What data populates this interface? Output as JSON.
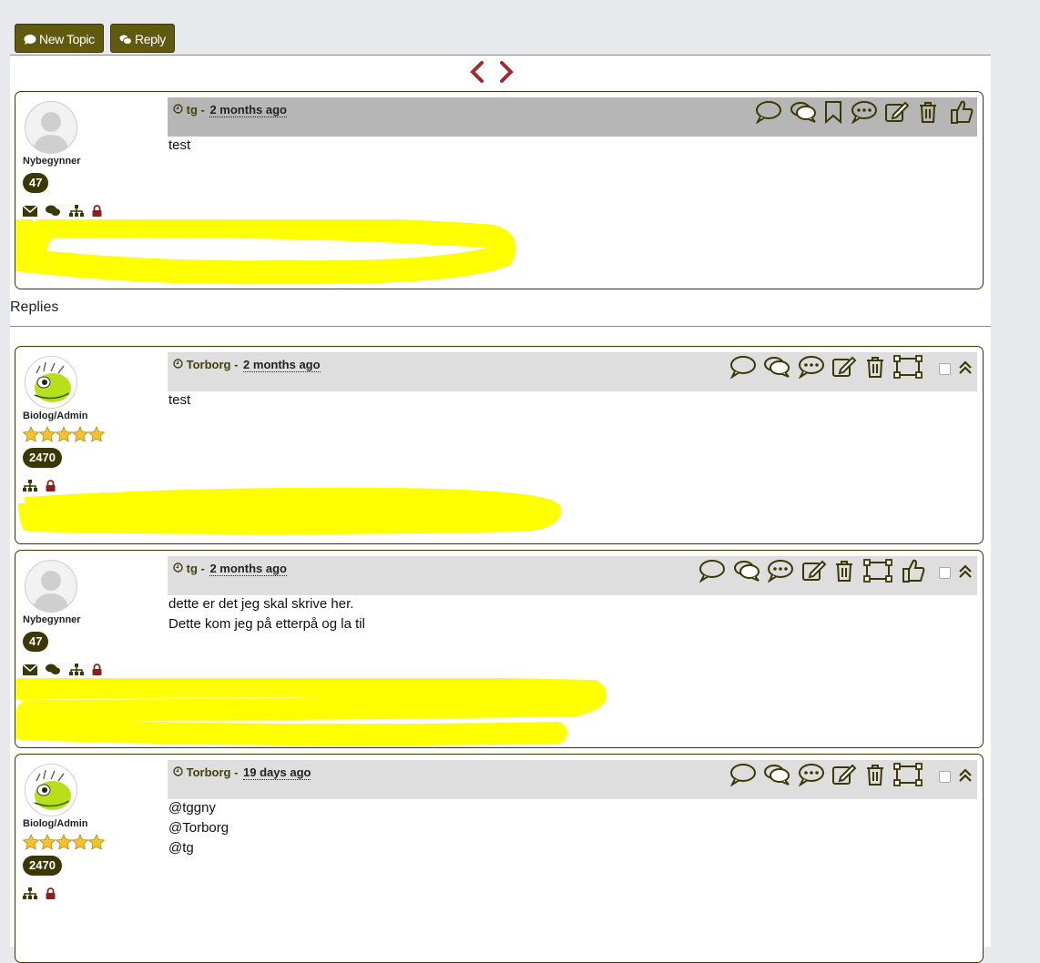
{
  "toolbar": {
    "new_topic_label": "New Topic",
    "reply_label": "Reply"
  },
  "replies_label": "Replies",
  "colors": {
    "accent": "#605a11",
    "border": "#3c3806",
    "highlight": "#ffff00",
    "nav_arrow": "#9e2b2b",
    "lock": "#8b1f1f"
  },
  "posts": [
    {
      "author": "tg",
      "time": "2 months ago",
      "rank": "Nybegynner",
      "count": "47",
      "lines": [
        "test"
      ]
    },
    {
      "author": "Torborg",
      "time": "2 months ago",
      "rank": "Biolog/Admin",
      "count": "2470",
      "lines": [
        "test"
      ]
    },
    {
      "author": "tg",
      "time": "2 months ago",
      "rank": "Nybegynner",
      "count": "47",
      "lines": [
        "dette er det jeg skal skrive her.",
        "Dette kom jeg på etterpå og la til"
      ]
    },
    {
      "author": "Torborg",
      "time": "19 days ago",
      "rank": "Biolog/Admin",
      "count": "2470",
      "lines": [
        "@tggny",
        "@Torborg",
        "@tg"
      ]
    }
  ]
}
